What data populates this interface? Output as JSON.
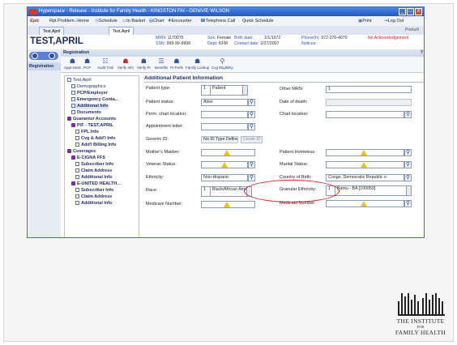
{
  "window": {
    "title": "Hyperspace - Release - Institute for Family Health - KINGSTON FAI - GENIVIE WILSON",
    "controls": [
      "_",
      "□",
      "X"
    ]
  },
  "menubar": {
    "app_logo": "Epic",
    "items": [
      "Rpt Problem",
      "Home",
      "Schedule",
      "In Basket",
      "Chart",
      "Encounter",
      "Telephone Call",
      "Quick Schedule"
    ],
    "right_items": [
      "Print",
      "Log Out"
    ],
    "right_label": "Prebuilt"
  },
  "tabs": [
    "Test,April",
    "Test,April"
  ],
  "patient": {
    "name": "TEST,APRIL",
    "mrn_label": "MRN:",
    "mrn": "1170075",
    "ssn_label": "SSN:",
    "ssn": "999-99-9999",
    "sex_label": "Sex:",
    "sex": "Female",
    "dept_label": "Dept:",
    "dept": "KFM",
    "birth_label": "Birth date:",
    "birth": "1/1/1972",
    "contact_label": "Contact date:",
    "contact": "2/27/2007",
    "phone_label": "Phone(h):",
    "phone": "972-370-4070",
    "notices_label": "Notices:",
    "ack": "No Acknowledgement"
  },
  "sidebar": {
    "active": "Registration"
  },
  "panel": {
    "title": "Registration",
    "help": "?"
  },
  "toolbar": [
    "Appt Desk",
    "PCP",
    "Audit Trail",
    "Verify Info",
    "Verify Pt",
    "Benefits",
    "Pt Prefs",
    "Family Lookup",
    "Cvg Eligibility"
  ],
  "tree": [
    {
      "label": "Test,April",
      "level": 0,
      "icon": "person"
    },
    {
      "label": "Demographics",
      "level": 1
    },
    {
      "label": "PCP/Employer",
      "level": 1,
      "bold": true
    },
    {
      "label": "Emergency Conta...",
      "level": 1,
      "bold": true
    },
    {
      "label": "Additional Info",
      "level": 1,
      "bold": true,
      "selected": true
    },
    {
      "label": "Documents",
      "level": 1,
      "bold": true
    },
    {
      "label": "Guarantor Accounts",
      "level": 0,
      "bold": true,
      "icon": "group"
    },
    {
      "label": "P/F - TEST,APRIL",
      "level": 1,
      "bold": true,
      "icon": "group"
    },
    {
      "label": "FPL Info",
      "level": 2,
      "bold": true
    },
    {
      "label": "Cvg & Add'l Info",
      "level": 2,
      "bold": true
    },
    {
      "label": "Add'l Billing Info",
      "level": 2,
      "bold": true
    },
    {
      "label": "Coverages",
      "level": 0,
      "bold": true,
      "icon": "group"
    },
    {
      "label": "E-CIGNA FFS",
      "level": 1,
      "bold": true,
      "icon": "group"
    },
    {
      "label": "Subscriber Info",
      "level": 2,
      "bold": true
    },
    {
      "label": "Claim Address",
      "level": 2,
      "bold": true
    },
    {
      "label": "Additional Info",
      "level": 2,
      "bold": true
    },
    {
      "label": "E-UNITED HEALTH...",
      "level": 1,
      "bold": true,
      "icon": "group"
    },
    {
      "label": "Subscriber Info",
      "level": 2,
      "bold": true
    },
    {
      "label": "Claim Address",
      "level": 2,
      "bold": true
    },
    {
      "label": "Additional Info",
      "level": 2,
      "bold": true
    }
  ],
  "form": {
    "section_title": "Additional Patient Information",
    "left_labels": [
      "Patient type:",
      "Patient status:",
      "Perm. chart location:",
      "Appointment letter:",
      "Generic ID:",
      "Mother's Maiden:",
      "Veteran Status:",
      "Ethnicity:",
      "Race:",
      "Medicare Number:"
    ],
    "patient_type_num": "1",
    "patient_type": "Patient",
    "patient_status": "Alive",
    "generic_id": "No ID Type Defined",
    "create_id": "Create ID",
    "ethnicity": "Non-Hispanic",
    "race_num": "1",
    "race": "Black/African American [",
    "right_labels": [
      "Other MRN:",
      "Date of death:",
      "Chart location:",
      "Patient Homeless:",
      "Marital Status:",
      "Country of Birth:",
      "Granular Ethnicity:",
      "Medicaid Number:"
    ],
    "other_mrn_num": "1",
    "country_of_birth": "Congo, Democratic Republic o",
    "granular_num": "1",
    "granular_ethnicity": "Bantu - BA [100050]"
  },
  "logo": {
    "line1": "THE INSTITUTE",
    "line2": "FOR",
    "line3": "FAMILY HEALTH"
  }
}
